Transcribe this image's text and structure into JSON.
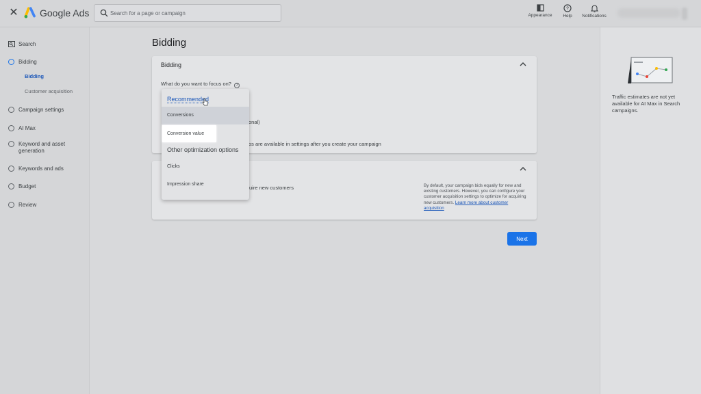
{
  "topbar": {
    "close_icon": "close-icon",
    "brand": "Google Ads",
    "search_placeholder": "Search for a page or campaign",
    "appearance_label": "Appearance",
    "help_label": "Help",
    "notifications_label": "Notifications"
  },
  "sidebar": {
    "items": [
      {
        "label": "Search"
      },
      {
        "label": "Bidding"
      },
      {
        "label": "Campaign settings"
      },
      {
        "label": "AI Max"
      },
      {
        "label": "Keyword and asset generation"
      },
      {
        "label": "Keywords and ads"
      },
      {
        "label": "Budget"
      },
      {
        "label": "Review"
      }
    ],
    "subitems": [
      {
        "label": "Bidding"
      },
      {
        "label": "Customer acquisition"
      }
    ]
  },
  "main": {
    "page_title": "Bidding",
    "card1": {
      "title": "Bidding",
      "question": "What do you want to focus on?",
      "partial_optional": "onal)",
      "partial_settings": "os are available in settings after you create your campaign"
    },
    "card2": {
      "partial_text": "uire new customers",
      "description": "By default, your campaign bids equally for new and existing customers. However, you can configure your customer acquisition settings to optimize for acquiring new customers.",
      "learn_more": "Learn more about customer acquisition"
    },
    "next_label": "Next"
  },
  "dropdown": {
    "recommended": "Recommended",
    "conversions": "Conversions",
    "conversion_value": "Conversion value",
    "other": "Other optimization options",
    "clicks": "Clicks",
    "impression_share": "Impression share"
  },
  "right_panel": {
    "text": "Traffic estimates are not yet available for AI Max in Search campaigns."
  },
  "colors": {
    "accent": "#1a73e8",
    "link": "#1a56b8"
  }
}
